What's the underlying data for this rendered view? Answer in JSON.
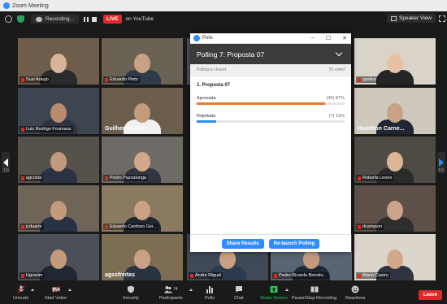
{
  "window": {
    "title": "Zoom Meeting"
  },
  "toolbar": {
    "recording_label": "Recording...",
    "live_label": "LIVE",
    "youtube_label": "on YouTube",
    "speaker_view_label": "Speaker View"
  },
  "gallery": {
    "page_left": "1/3",
    "page_right": "1/3",
    "tiles": [
      {
        "name": "Susi Araujo"
      },
      {
        "name": "Eduardo Pinto"
      },
      {
        "name": ""
      },
      {
        "name": "ypsilva"
      },
      {
        "name": "Luiz Rodrigo Fournaux"
      },
      {
        "name": "Guilherme Carr..."
      },
      {
        "name": "Hamilton Carne..."
      },
      {
        "name": "agcosta"
      },
      {
        "name": "Pedro Pazzalunga"
      },
      {
        "name": "Roberta Leone"
      },
      {
        "name": "jcduarte"
      },
      {
        "name": "Eduardo Cardoso Gei..."
      },
      {
        "name": "rlcampum"
      },
      {
        "name": "Hgravim"
      },
      {
        "name": "agssfreitas"
      },
      {
        "name": "Andre Miguel"
      },
      {
        "name": "Pedro Ricardo Brendo..."
      },
      {
        "name": "Alano Castro"
      }
    ]
  },
  "polls": {
    "window_title": "Polls",
    "heading": "Polling 7: Proposta 07",
    "status": "Polling is closed",
    "voted": "52 voted",
    "question": "1. Proposta 07",
    "options": [
      {
        "label": "Aprovada",
        "result": "(45) 87%",
        "pct": 87,
        "color": "#e6792b"
      },
      {
        "label": "Rejeitada",
        "result": "(7) 13%",
        "pct": 13,
        "color": "#2d8cff"
      }
    ],
    "share_label": "Share Results",
    "relaunch_label": "Re-launch Polling"
  },
  "bottom": {
    "unmute": "Unmute",
    "video": "Start Video",
    "security": "Security",
    "participants": "Participants",
    "participants_count": "74",
    "polls": "Polls",
    "chat": "Chat",
    "share": "Share Screen",
    "record": "Pause/Stop Recording",
    "reactions": "Reactions",
    "leave": "Leave"
  }
}
